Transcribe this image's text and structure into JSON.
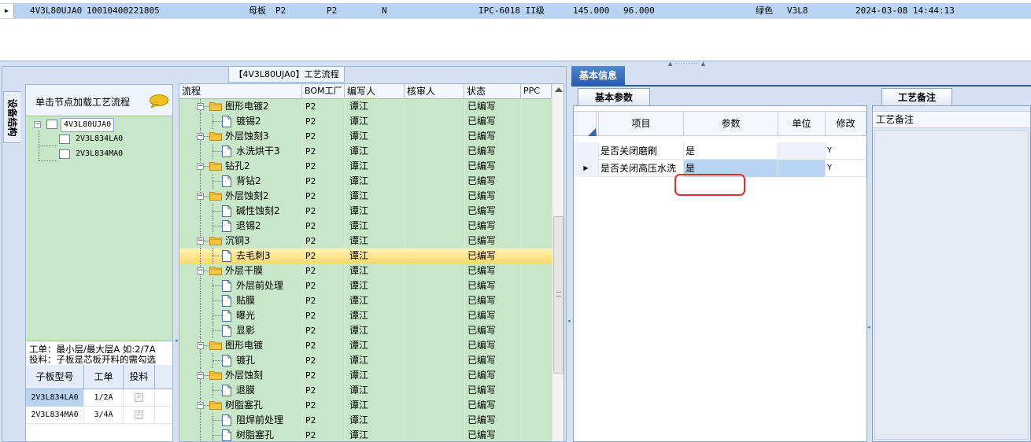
{
  "top_grid": {
    "row": {
      "code": "4V3L80UJA0",
      "number": "10010400221805",
      "board_type": "母板",
      "plant_a": "P2",
      "plant_b": "P2",
      "flag": "N",
      "spec": "IPC-6018 II级",
      "width": "145.000",
      "height": "96.000",
      "color": "绿色",
      "version": "V3L8",
      "timestamp": "2024-03-08 14:44:13"
    }
  },
  "left": {
    "title": "【4V3L80UJA0】工艺流程",
    "side_tab": "设备结构",
    "structure": {
      "header": "单击节点加载工艺流程",
      "root": "4V3L80UJA0",
      "children": [
        "2V3L834LA0",
        "2V3L834MA0"
      ],
      "hint_line1": "工单：最小层/最大层A 如:2/7A",
      "hint_line2": "投料：子板是芯板开料的需勾选",
      "sub_columns": [
        "子板型号",
        "工单",
        "投料"
      ],
      "sub_rows": [
        {
          "model": "2V3L834LA0",
          "order": "1/2A",
          "checked": "✓"
        },
        {
          "model": "2V3L834MA0",
          "order": "3/4A",
          "checked": "✓"
        }
      ]
    },
    "process": {
      "columns": [
        "流程",
        "BOM工厂",
        "编写人",
        "核审人",
        "状态",
        "PPC"
      ],
      "rows": [
        {
          "name": "图形电镀2",
          "kind": "folder",
          "bom": "P2",
          "writer": "谭江",
          "status": "已编写"
        },
        {
          "name": "镀锡2",
          "kind": "doc",
          "bom": "P2",
          "writer": "谭江",
          "status": "已编写"
        },
        {
          "name": "外层蚀刻3",
          "kind": "folder",
          "bom": "P2",
          "writer": "谭江",
          "status": "已编写"
        },
        {
          "name": "水洗烘干3",
          "kind": "doc",
          "bom": "P2",
          "writer": "谭江",
          "status": "已编写"
        },
        {
          "name": "钻孔2",
          "kind": "folder",
          "bom": "P2",
          "writer": "谭江",
          "status": "已编写"
        },
        {
          "name": "背钻2",
          "kind": "doc",
          "bom": "P2",
          "writer": "谭江",
          "status": "已编写"
        },
        {
          "name": "外层蚀刻2",
          "kind": "folder",
          "bom": "P2",
          "writer": "谭江",
          "status": "已编写"
        },
        {
          "name": "碱性蚀刻2",
          "kind": "doc",
          "bom": "P2",
          "writer": "谭江",
          "status": "已编写"
        },
        {
          "name": "退锡2",
          "kind": "doc",
          "bom": "P2",
          "writer": "谭江",
          "status": "已编写"
        },
        {
          "name": "沉铜3",
          "kind": "folder",
          "bom": "P2",
          "writer": "谭江",
          "status": "已编写"
        },
        {
          "name": "去毛刺3",
          "kind": "doc",
          "bom": "P2",
          "writer": "谭江",
          "status": "已编写"
        },
        {
          "name": "外层干膜",
          "kind": "folder",
          "bom": "P2",
          "writer": "谭江",
          "status": "已编写"
        },
        {
          "name": "外层前处理",
          "kind": "doc",
          "bom": "P2",
          "writer": "谭江",
          "status": "已编写"
        },
        {
          "name": "贴膜",
          "kind": "doc",
          "bom": "P2",
          "writer": "谭江",
          "status": "已编写"
        },
        {
          "name": "曝光",
          "kind": "doc",
          "bom": "P2",
          "writer": "谭江",
          "status": "已编写"
        },
        {
          "name": "显影",
          "kind": "doc",
          "bom": "P2",
          "writer": "谭江",
          "status": "已编写"
        },
        {
          "name": "图形电镀",
          "kind": "folder",
          "bom": "P2",
          "writer": "谭江",
          "status": "已编写"
        },
        {
          "name": "镀孔",
          "kind": "doc",
          "bom": "P2",
          "writer": "谭江",
          "status": "已编写"
        },
        {
          "name": "外层蚀刻",
          "kind": "folder",
          "bom": "P2",
          "writer": "谭江",
          "status": "已编写"
        },
        {
          "name": "退膜",
          "kind": "doc",
          "bom": "P2",
          "writer": "谭江",
          "status": "已编写"
        },
        {
          "name": "树脂塞孔",
          "kind": "folder",
          "bom": "P2",
          "writer": "谭江",
          "status": "已编写"
        },
        {
          "name": "阻焊前处理",
          "kind": "doc",
          "bom": "P2",
          "writer": "谭江",
          "status": "已编写"
        },
        {
          "name": "树脂塞孔",
          "kind": "doc",
          "bom": "P2",
          "writer": "谭江",
          "status": "已编写"
        }
      ],
      "selected_index": 10
    }
  },
  "right": {
    "main_tab": "基本信息",
    "params_tab": "基本参数",
    "param_columns": [
      "项目",
      "参数",
      "单位",
      "修改"
    ],
    "param_rows": [
      {
        "item": "是否关闭磨刷",
        "value": "是",
        "unit": "",
        "modify": "Y"
      },
      {
        "item": "是否关闭高压水洗",
        "value": "是",
        "unit": "",
        "modify": "Y"
      }
    ],
    "notes_tab": "工艺备注",
    "notes_label": "工艺备注"
  },
  "colors": {
    "tree_bg": "#c8e6c8",
    "selection_blue": "#b8d4f2",
    "selected_row": "#ffd86a",
    "tab_blue": "#2a5fa8",
    "highlight_red": "#e03030"
  }
}
